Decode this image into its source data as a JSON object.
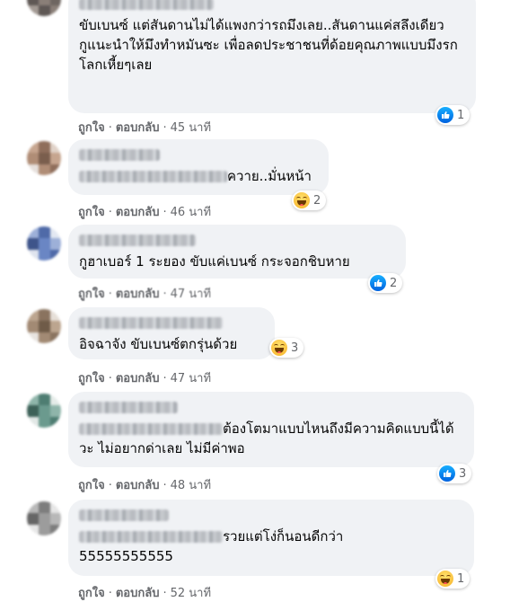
{
  "actions": {
    "like": "ถูกใจ",
    "reply": "ตอบกลับ",
    "sep": "·"
  },
  "comments": [
    {
      "text": "ขับเบนซ์ แต่สันดานไม่ได้แพงกว่ารถมึงเลย..สันดานแค่สลึงเดียว\nกูแนะนำให้มึงทำหมันซะ เพื่อลดประชาชนที่ด้อยคุณภาพแบบมึงรกโลกเหี้ยๆเลย",
      "time": "45 นาที",
      "reaction": {
        "type": "like-icon",
        "count": "1"
      },
      "avatar_colors": [
        "#8a7f78",
        "#6e6661",
        "#a39a94",
        "#5f5855"
      ]
    },
    {
      "text": "ควาย..มั่นหน้า",
      "time": "46 นาที",
      "reaction": {
        "type": "haha-icon",
        "count": "2"
      },
      "avatar_colors": [
        "#b08d76",
        "#8f6e5b",
        "#c6a58f",
        "#7a5e4d"
      ]
    },
    {
      "text": "กูฮาเบอร์ 1 ระยอง ขับแค่เบนซ์ กระจอกชิบหาย",
      "time": "47 นาที",
      "reaction": {
        "type": "like-icon",
        "count": "2"
      },
      "avatar_colors": [
        "#6a86c4",
        "#4f6aa8",
        "#9db0d8",
        "#3e548a"
      ]
    },
    {
      "text": "อิจฉาจัง ขับเบนซ์ตกรุ่นด้วย",
      "time": "47 นาที",
      "reaction": {
        "type": "haha-icon",
        "count": "3"
      },
      "avatar_colors": [
        "#a28a74",
        "#8a735f",
        "#bca58f",
        "#6f5b48"
      ]
    },
    {
      "text": "ต้องโตมาแบบไหนถึงมีความคิดแบบนี้ได้วะ ไม่อยากด่าเลย ไม่มีค่าพอ",
      "time": "48 นาที",
      "reaction": {
        "type": "like-icon",
        "count": "3"
      },
      "avatar_colors": [
        "#6b9a8e",
        "#4e7d72",
        "#8fb5aa",
        "#3d6158"
      ]
    },
    {
      "text": "รวยแต่โง่ก็นอนดีกว่า\n55555555555",
      "time": "52 นาที",
      "reaction": {
        "type": "haha-icon",
        "count": "1"
      },
      "avatar_colors": [
        "#9c9c9c",
        "#7d7d7d",
        "#b8b8b8",
        "#666666"
      ]
    }
  ]
}
